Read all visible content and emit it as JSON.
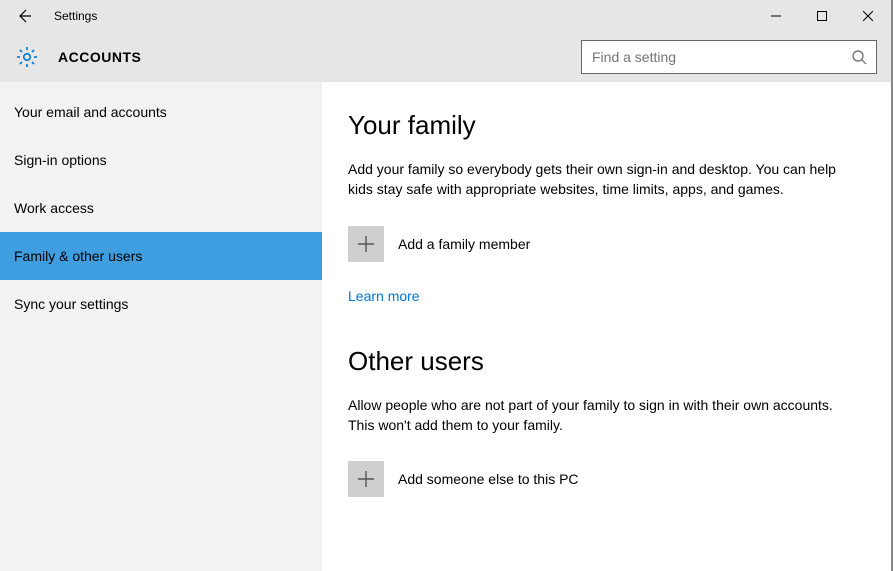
{
  "window": {
    "title": "Settings"
  },
  "header": {
    "breadcrumb": "ACCOUNTS",
    "search_placeholder": "Find a setting"
  },
  "sidebar": {
    "selected_index": 3,
    "items": [
      {
        "label": "Your email and accounts"
      },
      {
        "label": "Sign-in options"
      },
      {
        "label": "Work access"
      },
      {
        "label": "Family & other users"
      },
      {
        "label": "Sync your settings"
      }
    ]
  },
  "content": {
    "family": {
      "heading": "Your family",
      "description": "Add your family so everybody gets their own sign-in and desktop. You can help kids stay safe with appropriate websites, time limits, apps, and games.",
      "add_label": "Add a family member",
      "learn_more": "Learn more"
    },
    "others": {
      "heading": "Other users",
      "description": "Allow people who are not part of your family to sign in with their own accounts. This won't add them to your family.",
      "add_label": "Add someone else to this PC"
    }
  }
}
